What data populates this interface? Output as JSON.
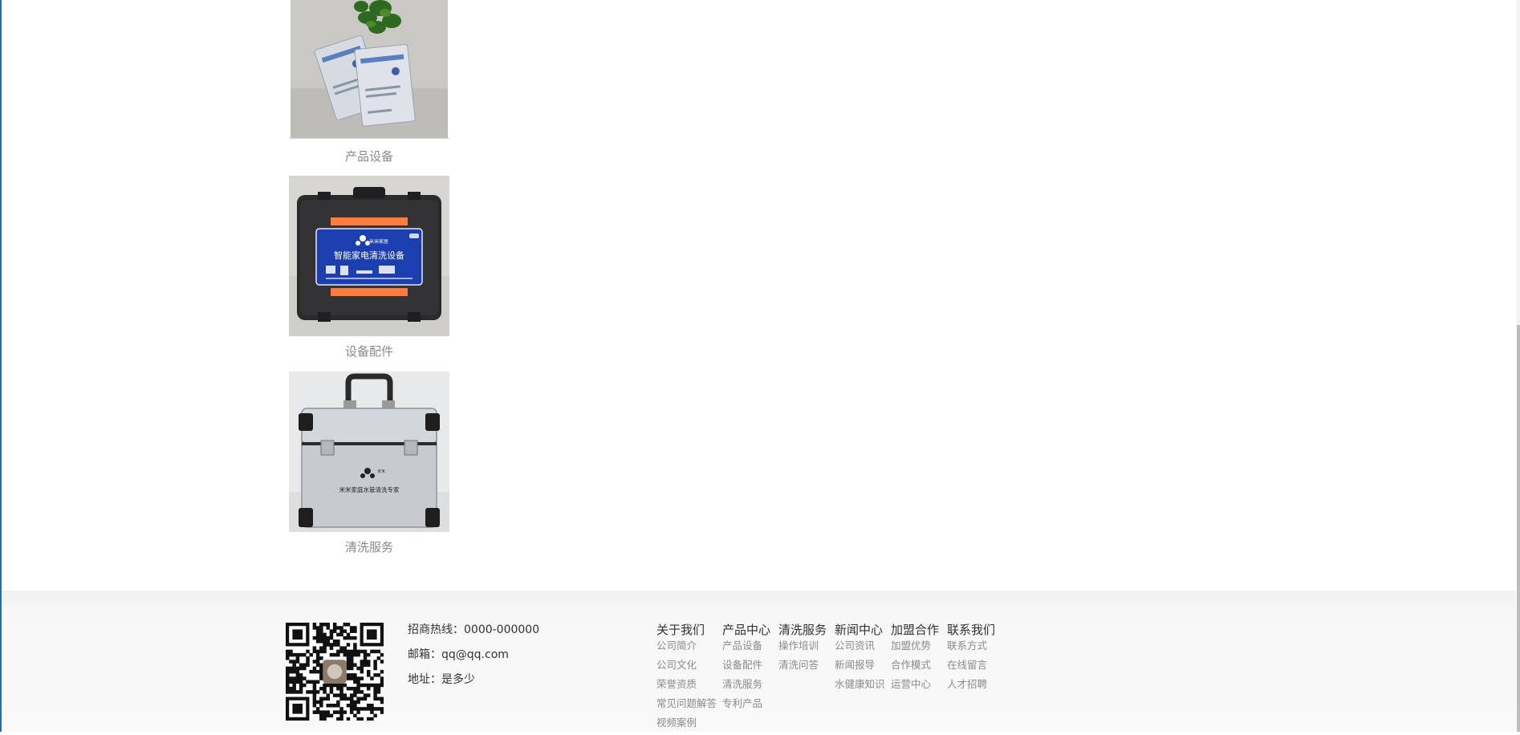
{
  "products": [
    {
      "caption": "产品设备",
      "image": "silver-packets-with-plant-photo"
    },
    {
      "caption": "设备配件",
      "image": "black-equipment-case-photo",
      "case_label": "智能家电清洗设备",
      "case_sublabel": "米米家居"
    },
    {
      "caption": "清洗服务",
      "image": "silver-aluminum-case-photo",
      "case_label": "米米家庭水管清洗专家",
      "case_sublabel": "米米"
    }
  ],
  "footer": {
    "qr_code": "qr-code",
    "hotline_label": "招商热线：",
    "hotline": "0000-000000",
    "email_label": "邮箱：",
    "email": "qq@qq.com",
    "address_label": "地址：",
    "address": "是多少",
    "columns": [
      {
        "title": "关于我们",
        "links": [
          "公司简介",
          "公司文化",
          "荣誉资质",
          "常见问题解答",
          "视频案例"
        ]
      },
      {
        "title": "产品中心",
        "links": [
          "产品设备",
          "设备配件",
          "清洗服务",
          "专利产品"
        ]
      },
      {
        "title": "清洗服务",
        "links": [
          "操作培训",
          "清洗问答"
        ]
      },
      {
        "title": "新闻中心",
        "links": [
          "公司资讯",
          "新闻报导",
          "水健康知识"
        ]
      },
      {
        "title": "加盟合作",
        "links": [
          "加盟优势",
          "合作模式",
          "运营中心"
        ]
      },
      {
        "title": "联系我们",
        "links": [
          "联系方式",
          "在线留言",
          "人才招聘"
        ]
      }
    ]
  },
  "colors": {
    "caption": "#8a8a8a",
    "footer_bg": "#f7f7f7",
    "left_edge": "#1f6fb5",
    "case_blue": "#1c3fb0",
    "case_orange": "#ff7a3d"
  }
}
